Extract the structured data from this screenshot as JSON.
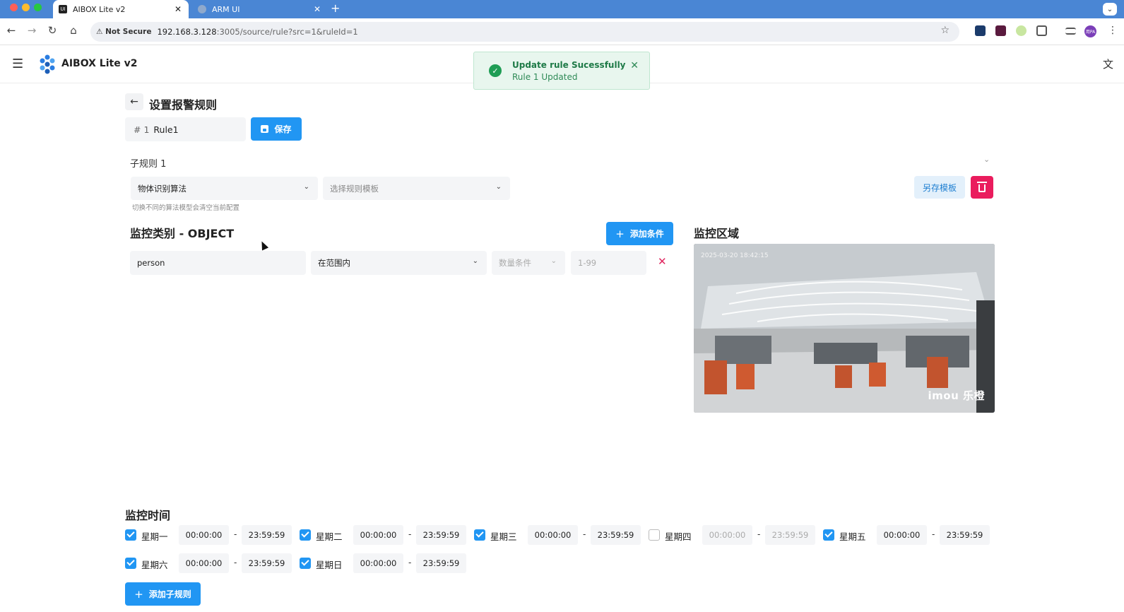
{
  "browser": {
    "tabs": [
      {
        "title": "AIBOX Lite v2",
        "active": true,
        "favicon_text": "UI"
      },
      {
        "title": "ARM UI",
        "active": false
      }
    ],
    "security_label": "Not Secure",
    "url_host": "192.168.3.128",
    "url_path": ":3005/source/rule?src=1&ruleId=1",
    "profile_initials": "用PA"
  },
  "app": {
    "title": "AIBOX Lite v2"
  },
  "toast": {
    "title": "Update rule Sucessfully",
    "message": "Rule 1 Updated"
  },
  "page": {
    "title": "设置报警规则",
    "rule_number": "1",
    "rule_name": "Rule1",
    "save_label": "保存"
  },
  "subrule": {
    "title": "子规则 1",
    "algorithm": "物体识别算法",
    "template_placeholder": "选择规则模板",
    "hint": "切换不同的算法模型会清空当前配置",
    "save_template_label": "另存模板"
  },
  "conditions": {
    "title": "监控类别 - OBJECT",
    "add_label": "添加条件",
    "rows": [
      {
        "object": "person",
        "scope": "在范围内",
        "count_condition": "数量条件",
        "count_range": "1-99"
      }
    ]
  },
  "region": {
    "title": "监控区域",
    "timestamp": "2025-03-20 18:42:15",
    "watermark": "imou 乐橙"
  },
  "schedule": {
    "title": "监控时间",
    "days": [
      {
        "label": "星期一",
        "checked": true,
        "start": "00:00:00",
        "end": "23:59:59"
      },
      {
        "label": "星期二",
        "checked": true,
        "start": "00:00:00",
        "end": "23:59:59"
      },
      {
        "label": "星期三",
        "checked": true,
        "start": "00:00:00",
        "end": "23:59:59"
      },
      {
        "label": "星期四",
        "checked": false,
        "start": "00:00:00",
        "end": "23:59:59"
      },
      {
        "label": "星期五",
        "checked": true,
        "start": "00:00:00",
        "end": "23:59:59"
      },
      {
        "label": "星期六",
        "checked": true,
        "start": "00:00:00",
        "end": "23:59:59"
      },
      {
        "label": "星期日",
        "checked": true,
        "start": "00:00:00",
        "end": "23:59:59"
      }
    ],
    "separator": "-",
    "add_subrule_label": "添加子规则"
  },
  "colors": {
    "primary": "#2196f3",
    "danger": "#ea1c5d",
    "success": "#1f9d55",
    "chrome_tabbar": "#4a86d4"
  }
}
